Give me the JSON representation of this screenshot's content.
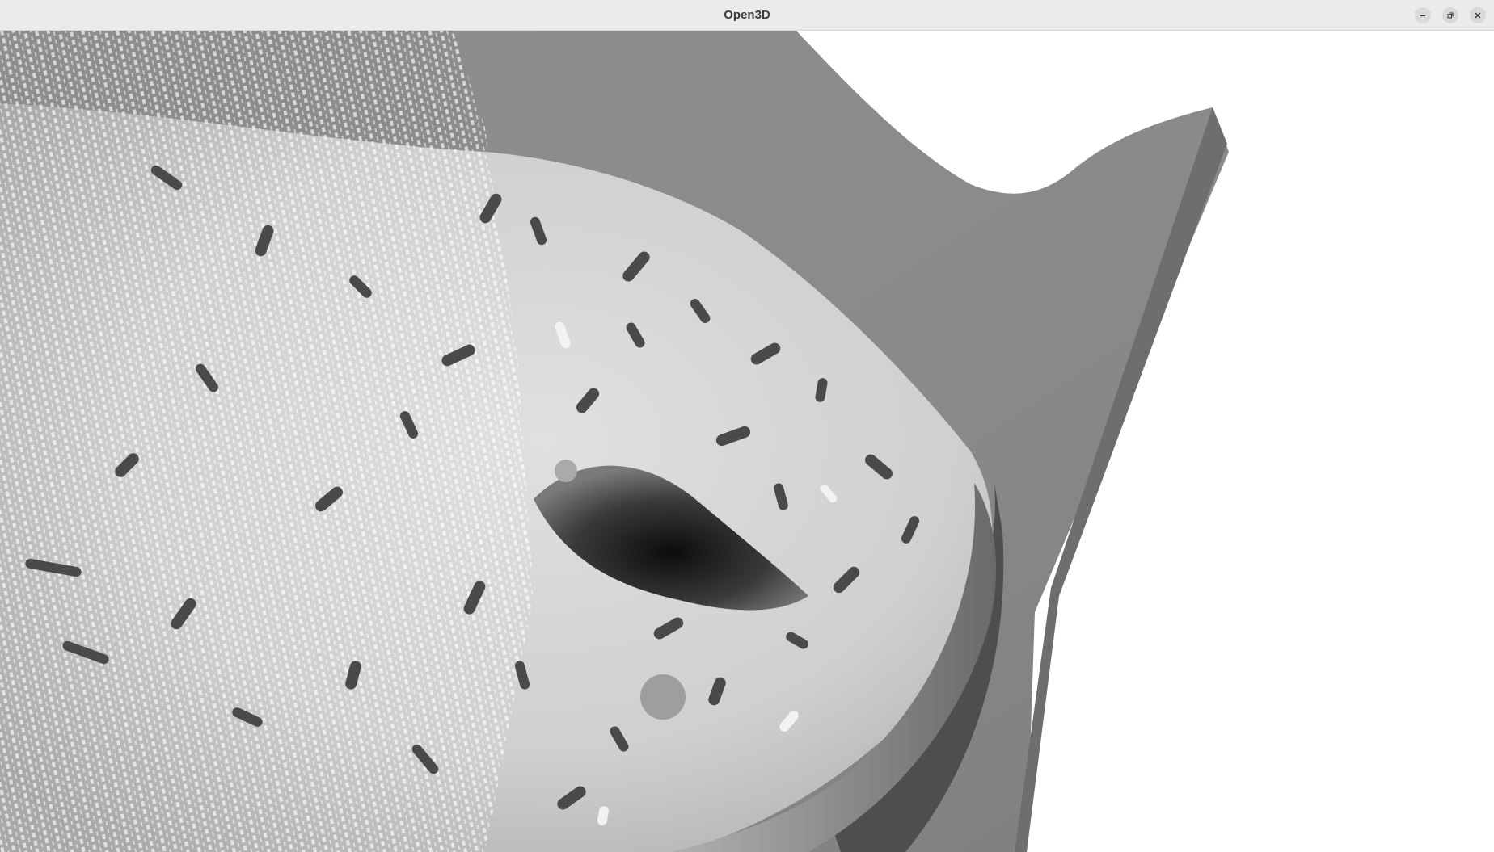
{
  "window": {
    "title": "Open3D",
    "controls": {
      "minimize_icon": "minimize-icon",
      "maximize_icon": "restore-icon",
      "close_icon": "close-icon"
    }
  },
  "viewport": {
    "content": "point-cloud-render",
    "background_color": "#ffffff",
    "surface_color": "#8c8c8c",
    "object_color": "#d2d2d2"
  }
}
